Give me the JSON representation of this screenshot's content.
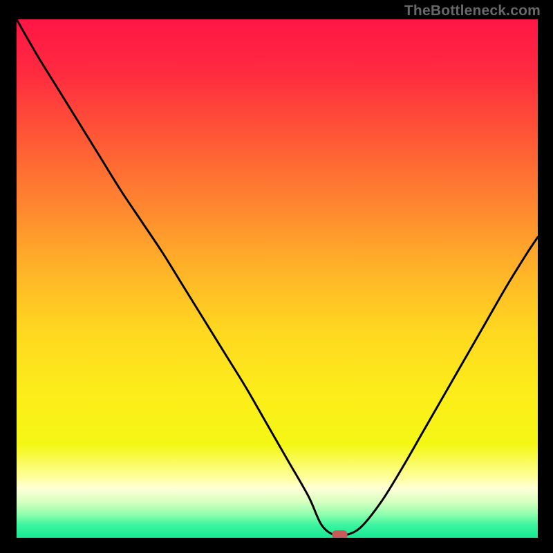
{
  "watermark": "TheBottleneck.com",
  "chart_data": {
    "type": "line",
    "title": "",
    "xlabel": "",
    "ylabel": "",
    "xlim": [
      0,
      100
    ],
    "ylim": [
      0,
      100
    ],
    "grid": false,
    "series": [
      {
        "name": "bottleneck-curve",
        "x": [
          0,
          4,
          8,
          12,
          16,
          20,
          24,
          28,
          32,
          36,
          40,
          44,
          48,
          52,
          56,
          58.5,
          61,
          63,
          66,
          70,
          74,
          78,
          82,
          86,
          90,
          94,
          98,
          100
        ],
        "y": [
          100,
          93,
          86.5,
          80,
          73.5,
          67,
          61,
          55,
          48.5,
          42,
          35.5,
          29,
          22,
          15,
          8,
          2.5,
          0.5,
          0.5,
          2,
          7,
          13.5,
          20.5,
          27.5,
          34.5,
          41.5,
          48.5,
          55,
          58
        ]
      }
    ],
    "marker": {
      "x": 62,
      "y": 0.5
    },
    "background_gradient": {
      "stops": [
        {
          "offset": 0.0,
          "color": "#ff1646"
        },
        {
          "offset": 0.1,
          "color": "#ff2a40"
        },
        {
          "offset": 0.22,
          "color": "#ff5536"
        },
        {
          "offset": 0.35,
          "color": "#ff8330"
        },
        {
          "offset": 0.48,
          "color": "#ffb228"
        },
        {
          "offset": 0.6,
          "color": "#ffd720"
        },
        {
          "offset": 0.72,
          "color": "#fced1a"
        },
        {
          "offset": 0.82,
          "color": "#f4f714"
        },
        {
          "offset": 0.885,
          "color": "#ffffa0"
        },
        {
          "offset": 0.905,
          "color": "#ffffd8"
        },
        {
          "offset": 0.93,
          "color": "#d8ffc0"
        },
        {
          "offset": 0.955,
          "color": "#8effae"
        },
        {
          "offset": 0.975,
          "color": "#3cf5a0"
        },
        {
          "offset": 1.0,
          "color": "#18e893"
        }
      ]
    }
  }
}
